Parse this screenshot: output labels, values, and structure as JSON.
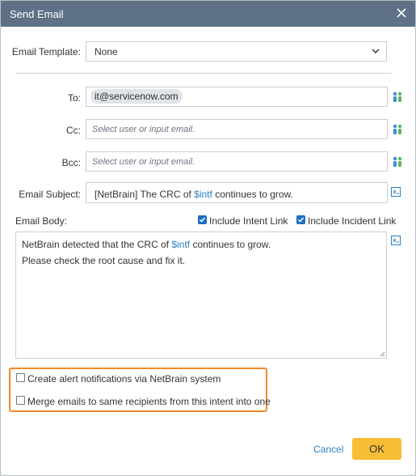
{
  "dialog": {
    "title": "Send Email"
  },
  "icons": {
    "close": "close-icon",
    "dropdown": "chevron-down-icon",
    "people": "people-icon",
    "variable": "variable-icon"
  },
  "template": {
    "label": "Email Template:",
    "value": "None"
  },
  "to": {
    "label": "To:",
    "chip": "it@servicenow.com"
  },
  "cc": {
    "label": "Cc:",
    "placeholder": "Select user or input email."
  },
  "bcc": {
    "label": "Bcc:",
    "placeholder": "Select user or input email."
  },
  "subject": {
    "label": "Email Subject:",
    "prefix": "[NetBrain] The CRC of ",
    "var": "$intf",
    "suffix": " continues to grow."
  },
  "body": {
    "label": "Email Body:",
    "include_intent": {
      "label": "Include Intent Link",
      "checked": true
    },
    "include_incident": {
      "label": "Include Incident Link",
      "checked": true
    },
    "line1_prefix": "NetBrain detected that the CRC of ",
    "line1_var": "$intf",
    "line1_suffix": " continues to grow.",
    "line2": "Please check the root cause and fix it."
  },
  "options": {
    "create_alert": {
      "label": "Create alert notifications via NetBrain system",
      "checked": false
    },
    "merge_emails": {
      "label": "Merge emails to same recipients from this intent into one",
      "checked": false
    }
  },
  "footer": {
    "cancel": "Cancel",
    "ok": "OK"
  },
  "colors": {
    "titlebar": "#5e7186",
    "accent": "#2f7fc1",
    "ok_button": "#f8bd35",
    "highlight": "#f08a2c",
    "checkbox": "#1b6fc4"
  }
}
